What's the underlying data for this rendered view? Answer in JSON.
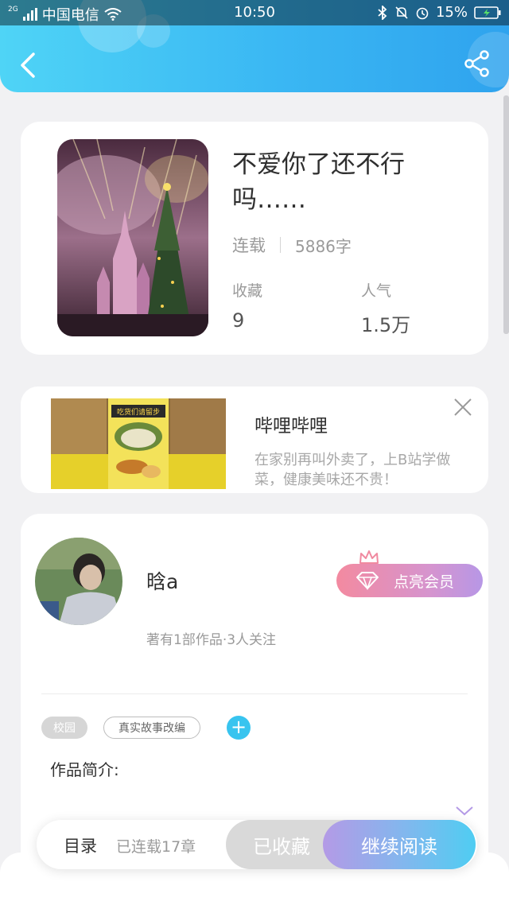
{
  "status_bar": {
    "carrier_tag": "2G",
    "carrier": "中国电信",
    "time": "10:50",
    "battery": "15%",
    "icons": [
      "signal-icon",
      "wifi-icon",
      "bluetooth-icon",
      "mute-icon",
      "alarm-icon",
      "battery-icon"
    ]
  },
  "header": {
    "back_icon": "back-arrow-icon",
    "share_icon": "share-icon",
    "accent": "#3ab7f3"
  },
  "book": {
    "title": "不爱你了还不行吗……",
    "status": "连载",
    "word_count": "5886字",
    "favorites_label": "收藏",
    "favorites_value": "9",
    "popularity_label": "人气",
    "popularity_value": "1.5万"
  },
  "ad": {
    "title": "哔哩哔哩",
    "description": "在家别再叫外卖了，上B站学做菜，健康美味还不贵！",
    "image_caption": "吃货们请留步",
    "close_icon": "close-icon"
  },
  "author": {
    "name": "晗a",
    "info": "著有1部作品·3人关注",
    "vip_button": "点亮会员",
    "tags": [
      "校园",
      "真实故事改编"
    ],
    "add_tag": "+",
    "intro_label": "作品简介:"
  },
  "bottom_bar": {
    "toc": "目录",
    "chapters": "已连载17章",
    "favorited": "已收藏",
    "continue_reading": "继续阅读"
  }
}
